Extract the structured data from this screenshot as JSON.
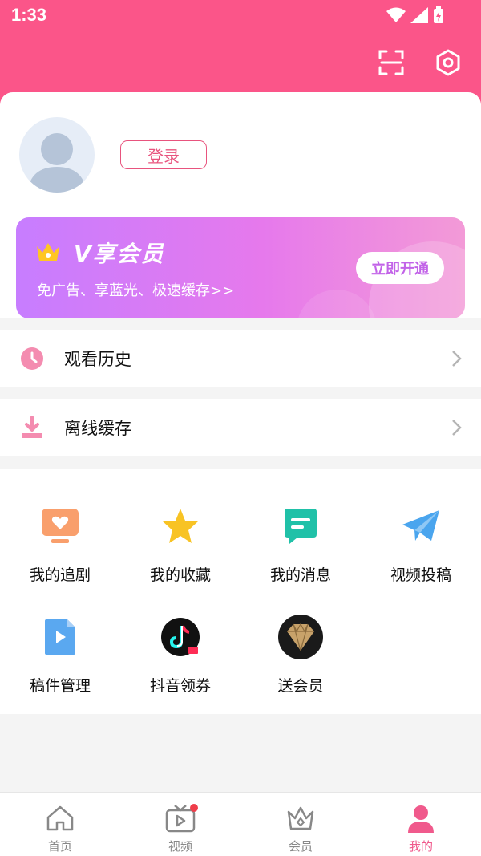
{
  "status_bar": {
    "time": "1:33"
  },
  "profile": {
    "login_label": "登录"
  },
  "vip": {
    "title": "V享会员",
    "subtitle": "免广告、享蓝光、极速缓存>>",
    "cta": "立即开通"
  },
  "list": [
    {
      "label": "观看历史",
      "icon": "clock-icon"
    },
    {
      "label": "离线缓存",
      "icon": "download-icon"
    }
  ],
  "grid": [
    {
      "label": "我的追剧",
      "icon": "tv-heart-icon",
      "color": "#f99f6c"
    },
    {
      "label": "我的收藏",
      "icon": "star-icon",
      "color": "#f8c324"
    },
    {
      "label": "我的消息",
      "icon": "message-icon",
      "color": "#20c1a8"
    },
    {
      "label": "视频投稿",
      "icon": "paper-plane-icon",
      "color": "#4aa5ee"
    },
    {
      "label": "稿件管理",
      "icon": "video-file-icon",
      "color": "#5aa8f0"
    },
    {
      "label": "抖音领券",
      "icon": "tiktok-icon",
      "color": "#111111"
    },
    {
      "label": "送会员",
      "icon": "diamond-icon",
      "color": "#c8a26a"
    }
  ],
  "tabbar": [
    {
      "label": "首页",
      "icon": "home-icon",
      "active": false
    },
    {
      "label": "视频",
      "icon": "tv-play-icon",
      "active": false,
      "badge": true
    },
    {
      "label": "会员",
      "icon": "crown-icon",
      "active": false
    },
    {
      "label": "我的",
      "icon": "user-icon",
      "active": true
    }
  ],
  "colors": {
    "brand": "#fb5589",
    "accent": "#f05a8c",
    "vip_gradient_start": "#c77dff",
    "vip_gradient_end": "#f39ad7"
  }
}
